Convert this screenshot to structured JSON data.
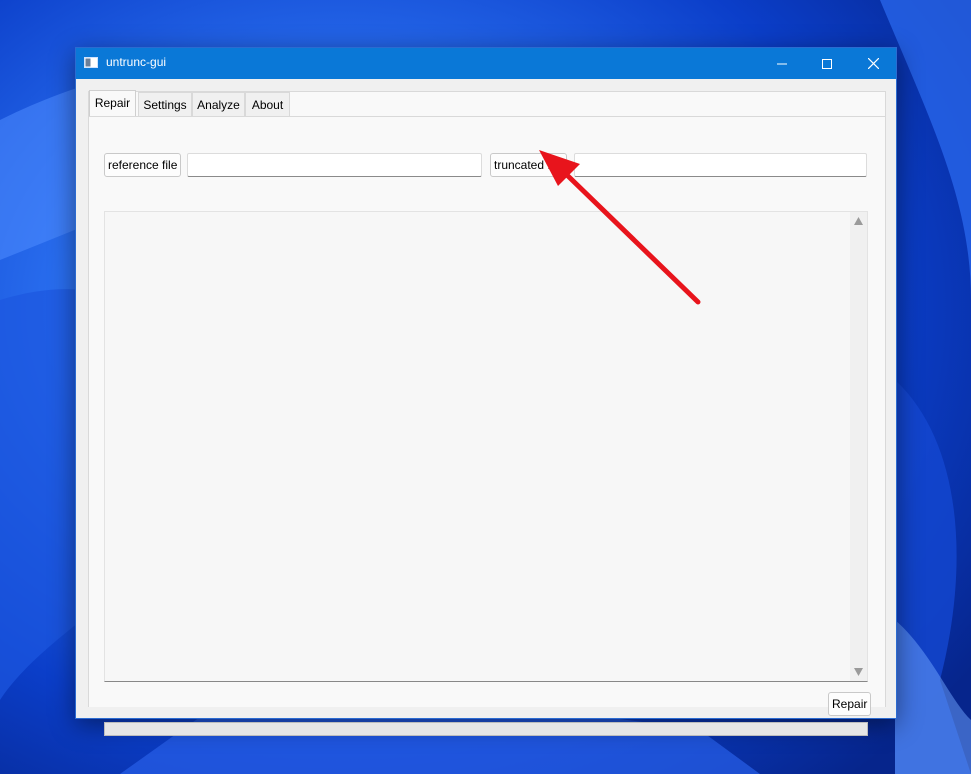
{
  "window": {
    "title": "untrunc-gui"
  },
  "tabs": [
    {
      "label": "Repair",
      "active": true
    },
    {
      "label": "Settings",
      "active": false
    },
    {
      "label": "Analyze",
      "active": false
    },
    {
      "label": "About",
      "active": false
    }
  ],
  "repair": {
    "reference_button": "reference file",
    "reference_value": "",
    "truncated_button": "truncated file",
    "truncated_value": "",
    "log_text": "",
    "repair_button": "Repair",
    "progress_fraction": 0
  },
  "colors": {
    "titlebar": "#0a78d7",
    "annotation_arrow": "#e8141c",
    "progress_fill": "#06b025"
  }
}
